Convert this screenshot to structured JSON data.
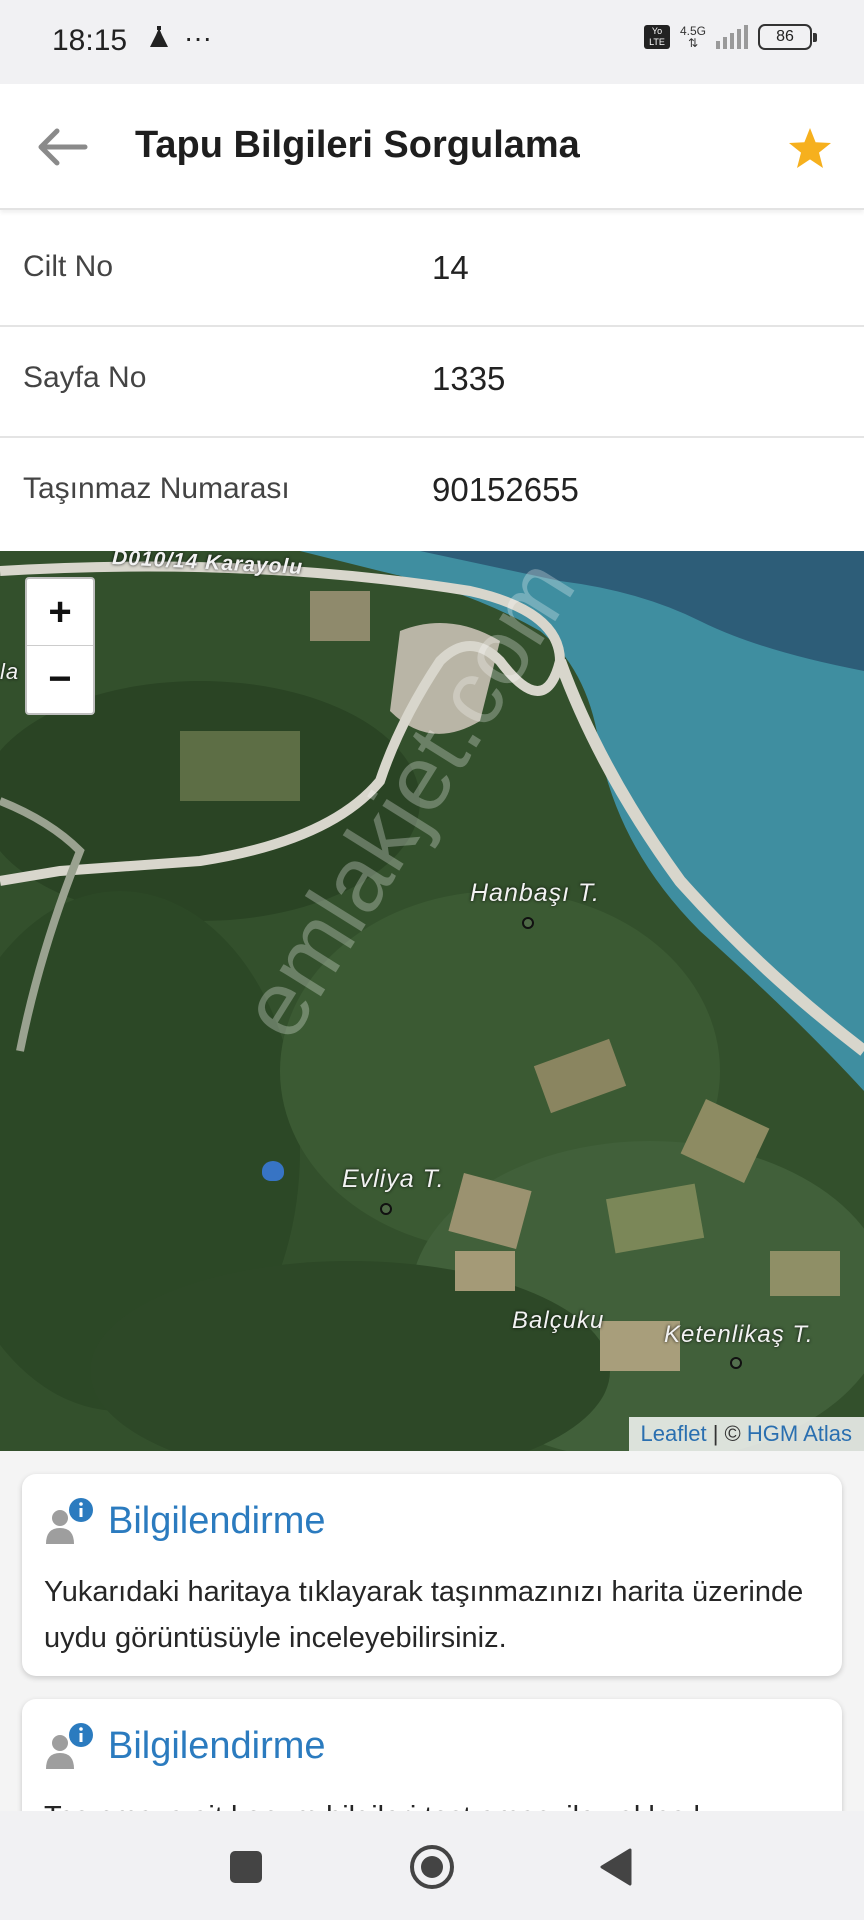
{
  "status_bar": {
    "time": "18:15",
    "dots": "···",
    "volte": "Yo LTE",
    "network": "4.5G",
    "battery": "86"
  },
  "app_bar": {
    "title": "Tapu Bilgileri Sorgulama",
    "back_icon": "arrow-left-icon",
    "favorite_icon": "star-icon",
    "favorite_color": "#f6b01e"
  },
  "info_rows": [
    {
      "label": "Cilt No",
      "value": "14"
    },
    {
      "label": "Sayfa No",
      "value": "1335"
    },
    {
      "label": "Taşınmaz Numarası",
      "value": "90152655"
    }
  ],
  "map": {
    "zoom_in": "+",
    "zoom_out": "−",
    "labels": {
      "road": "D010/14 Karayolu",
      "partial": "la",
      "hanbasi": "Hanbaşı T.",
      "evliya": "Evliya T.",
      "balcuku": "Balçuku",
      "ketenlikas": "Ketenlikaş T."
    },
    "watermark": "emlakjet.com",
    "attribution": {
      "leaflet": "Leaflet",
      "separator": " | © ",
      "hgm": "HGM Atlas"
    }
  },
  "cards": [
    {
      "title": "Bilgilendirme",
      "body": "Yukarıdaki haritaya tıklayarak taşınmazınızı harita üzerinde uydu görüntüsüyle inceleyebilirsiniz."
    },
    {
      "title": "Bilgilendirme",
      "body": "Taşınmaza ait konum bilgileri test amacı ile yaklaşık"
    }
  ],
  "colors": {
    "accent_blue": "#2b7bbf",
    "sea": "#3f8ea0"
  }
}
